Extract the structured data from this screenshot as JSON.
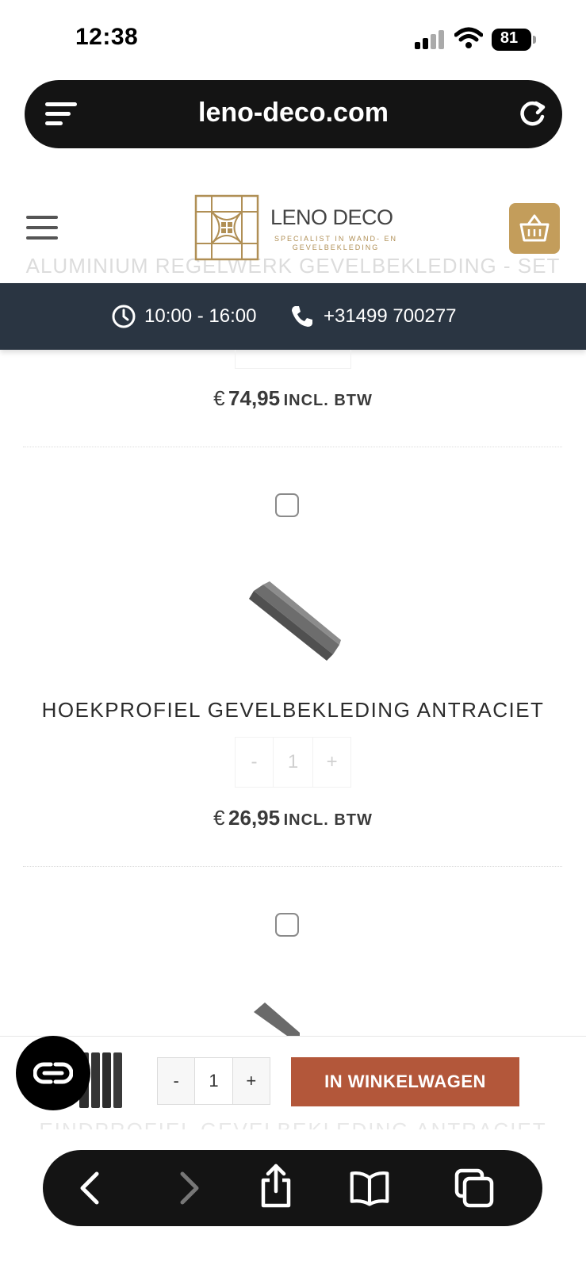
{
  "status_bar": {
    "time": "12:38",
    "battery": "81"
  },
  "browser": {
    "url": "leno-deco.com"
  },
  "header": {
    "logo_name": "LENO DECO",
    "logo_sub": "SPECIALIST IN WAND- EN GEVELBEKLEDING",
    "ghost_title": "ALUMINIUM REGELWERK GEVELBEKLEDING - SET"
  },
  "info_bar": {
    "hours": "10:00 - 16:00",
    "phone": "+31499 700277"
  },
  "products": [
    {
      "price_currency": "€",
      "price": "74,95",
      "price_suffix": "INCL. BTW"
    },
    {
      "title": "HOEKPROFIEL GEVELBEKLEDING ANTRACIET",
      "qty_minus": "-",
      "qty": "1",
      "qty_plus": "+",
      "price_currency": "€",
      "price": "26,95",
      "price_suffix": "INCL. BTW"
    }
  ],
  "sticky": {
    "minus": "-",
    "qty": "1",
    "plus": "+",
    "add_to_cart": "IN WINKELWAGEN"
  },
  "ghost_bottom_title": "EINDPROFIEL GEVELBEKLEDING ANTRACIET",
  "icons": {
    "status": [
      "signal-icon",
      "wifi-icon",
      "battery-icon"
    ],
    "url_bar": [
      "page-menu-icon",
      "reload-icon"
    ],
    "header": [
      "hamburger-icon",
      "logo-mark-icon",
      "cart-icon"
    ],
    "info": [
      "clock-icon",
      "phone-icon"
    ],
    "toolbar": [
      "back-icon",
      "forward-icon",
      "share-icon",
      "bookmarks-icon",
      "tabs-icon"
    ],
    "chat": "chat-icon"
  },
  "colors": {
    "info_bar": "#2a3542",
    "cart_gold": "#c39d5b",
    "add_to_cart": "#b3573a",
    "logo_gold": "#b08f55"
  }
}
